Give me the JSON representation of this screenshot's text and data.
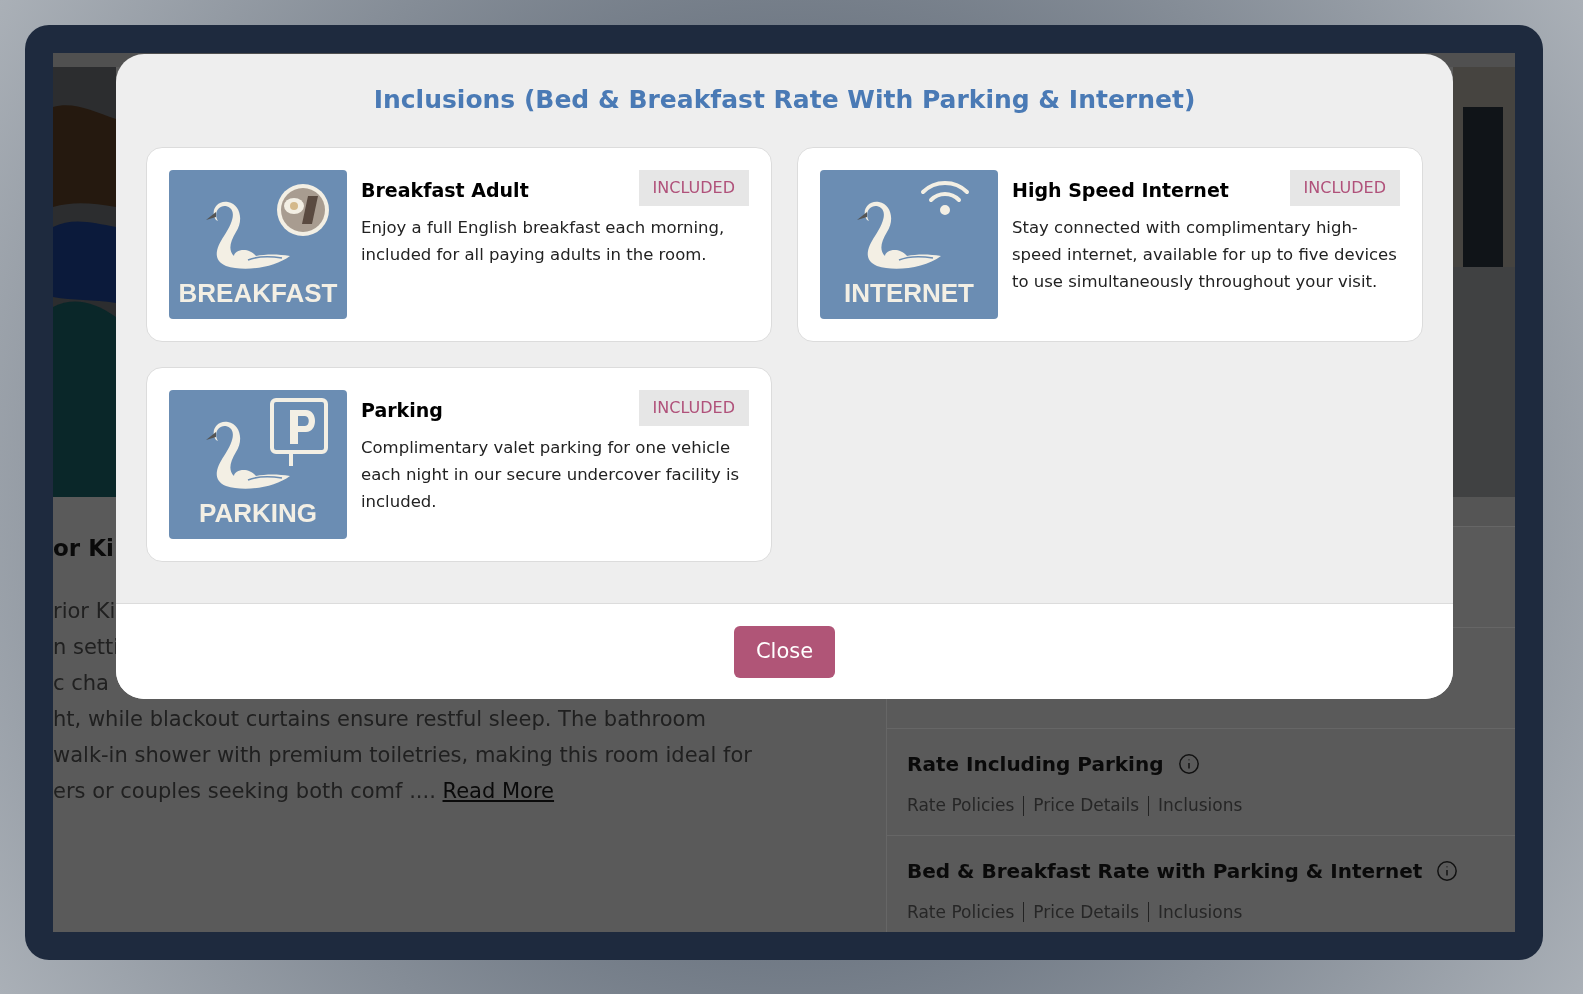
{
  "background_page": {
    "heading_fragment": "or Ki",
    "description_lines": [
      "rior Ki",
      "n setti",
      "c cha",
      "ht, while blackout curtains ensure restful sleep. The bathroom",
      "walk-in shower with premium toiletries, making this room ideal for",
      "ers or couples seeking both comf ...."
    ],
    "read_more": "Read More",
    "rates": [
      {
        "name": "Rate Including Parking",
        "links": [
          "Rate Policies",
          "Price Details",
          "Inclusions"
        ]
      },
      {
        "name": "Bed & Breakfast Rate with Parking & Internet",
        "links": [
          "Rate Policies",
          "Price Details",
          "Inclusions"
        ]
      }
    ]
  },
  "modal": {
    "title": "Inclusions (Bed & Breakfast Rate With Parking & Internet)",
    "inclusions": [
      {
        "kind": "breakfast",
        "image_label": "BREAKFAST",
        "name": "Breakfast Adult",
        "badge": "INCLUDED",
        "description": "Enjoy a full English breakfast each morning, included for all paying adults in the room."
      },
      {
        "kind": "internet",
        "image_label": "INTERNET",
        "name": "High Speed Internet",
        "badge": "INCLUDED",
        "description": "Stay connected with complimentary high-speed internet, available for up to five devices to use simultaneously throughout your visit."
      },
      {
        "kind": "parking",
        "image_label": "PARKING",
        "name": "Parking",
        "badge": "INCLUDED",
        "description": "Complimentary valet parking for one vehicle each night in our secure undercover facility is included."
      }
    ],
    "close_button": "Close"
  }
}
